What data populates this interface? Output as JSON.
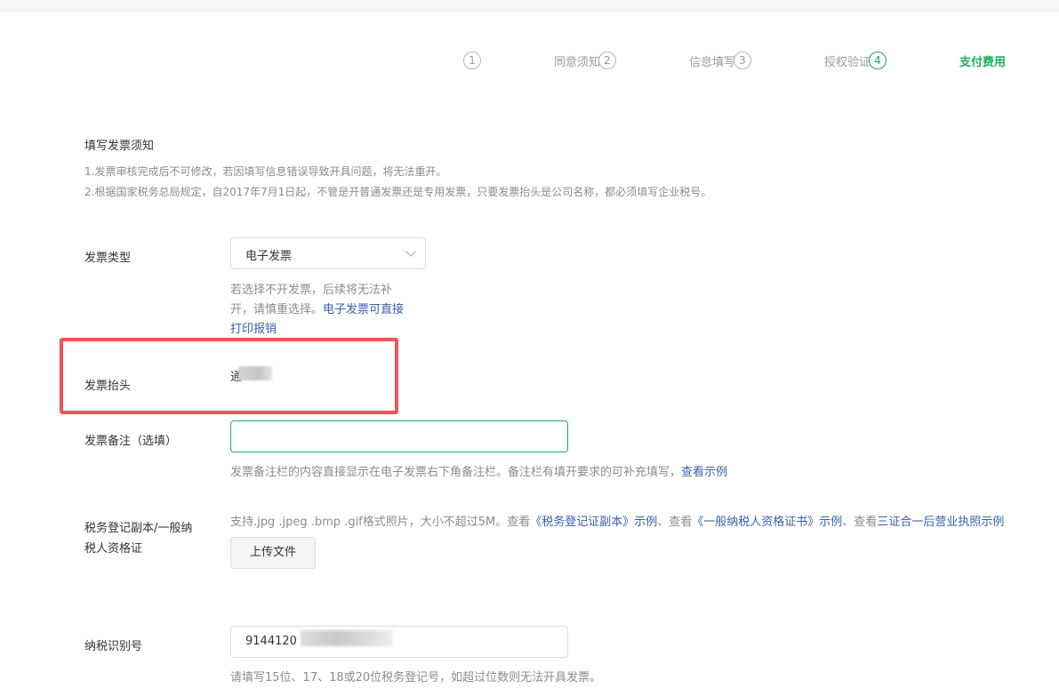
{
  "steps": [
    {
      "num": "1",
      "label": "同意须知"
    },
    {
      "num": "2",
      "label": "信息填写"
    },
    {
      "num": "3",
      "label": "授权验证"
    },
    {
      "num": "4",
      "label": "支付费用",
      "active": true
    }
  ],
  "notice": {
    "title": "填写发票须知",
    "line1": "1.发票审核完成后不可修改，若因填写信息错误导致开具问题，将无法重开。",
    "line2": "2.根据国家税务总局规定，自2017年7月1日起，不管是开普通发票还是专用发票，只要发票抬头是公司名称，都必须填写企业税号。"
  },
  "invoice_type": {
    "label": "发票类型",
    "value": "电子发票",
    "hint_line1": "若选择不开发票，后续将无法补",
    "hint_line2_plain": "开，请慎重选择。",
    "hint_line2_link": "电子发票可直接",
    "hint_line3_link": "打印报销"
  },
  "invoice_title": {
    "label": "发票抬头",
    "value": "通"
  },
  "invoice_remark": {
    "label": "发票备注（选填）",
    "value": "",
    "hint_plain": "发票备注栏的内容直接显示在电子发票右下角备注栏。备注栏有填开要求的可补充填写，",
    "hint_link": "查看示例"
  },
  "tax_cert": {
    "label_line1": "税务登记副本/一般纳",
    "label_line2": "税人资格证",
    "hint_a": "支持.jpg .jpeg .bmp .gif格式照片，大小不超过5M。查看",
    "link_a": "《税务登记证副本》示例",
    "hint_b": "、查看",
    "link_b": "《一般纳税人资格证书》示例",
    "hint_c": "、查看",
    "link_c": "三证合一后营业执照示例",
    "upload_label": "上传文件"
  },
  "tax_id": {
    "label": "纳税识别号",
    "value": "9144120",
    "hint": "请填写15位、17、18或20位税务登记号，如超过位数则无法开具发票。"
  },
  "colors": {
    "accent": "#1aad5b",
    "link": "#3a5fa8",
    "highlight": "#f0545a"
  }
}
